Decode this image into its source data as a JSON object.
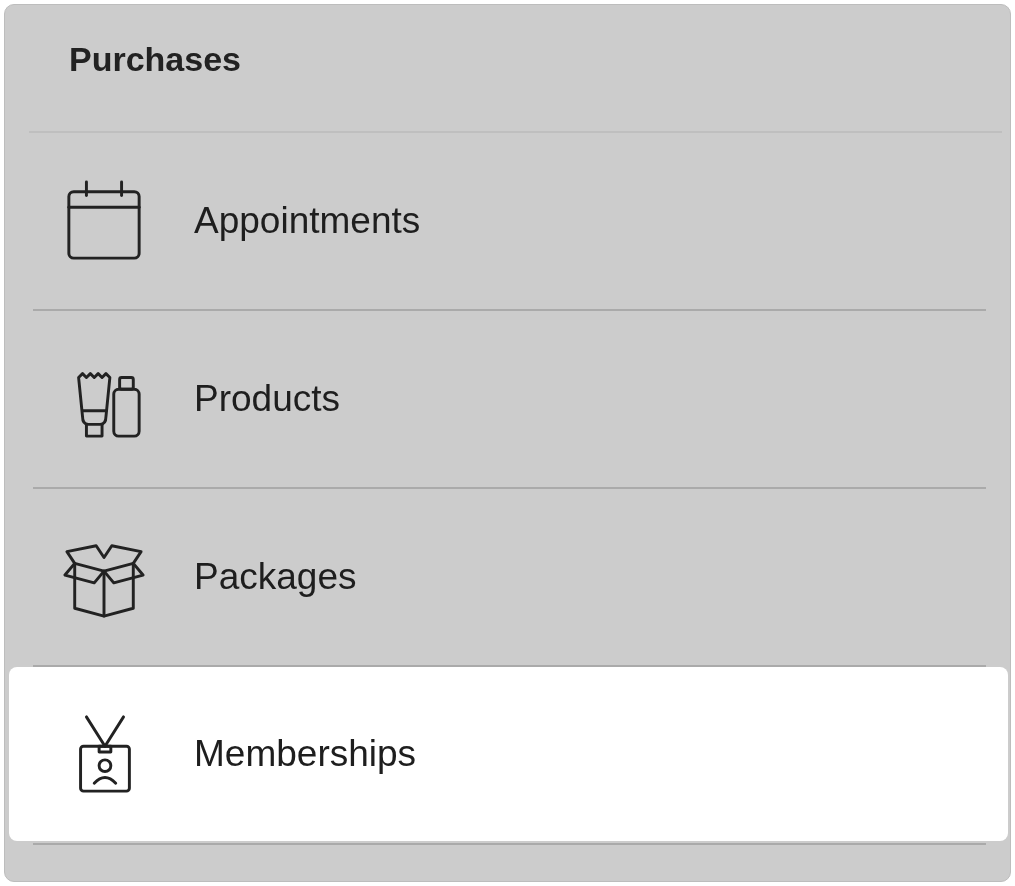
{
  "title": "Purchases",
  "items": [
    {
      "label": "Appointments",
      "selected": false
    },
    {
      "label": "Products",
      "selected": false
    },
    {
      "label": "Packages",
      "selected": false
    },
    {
      "label": "Memberships",
      "selected": true
    }
  ]
}
